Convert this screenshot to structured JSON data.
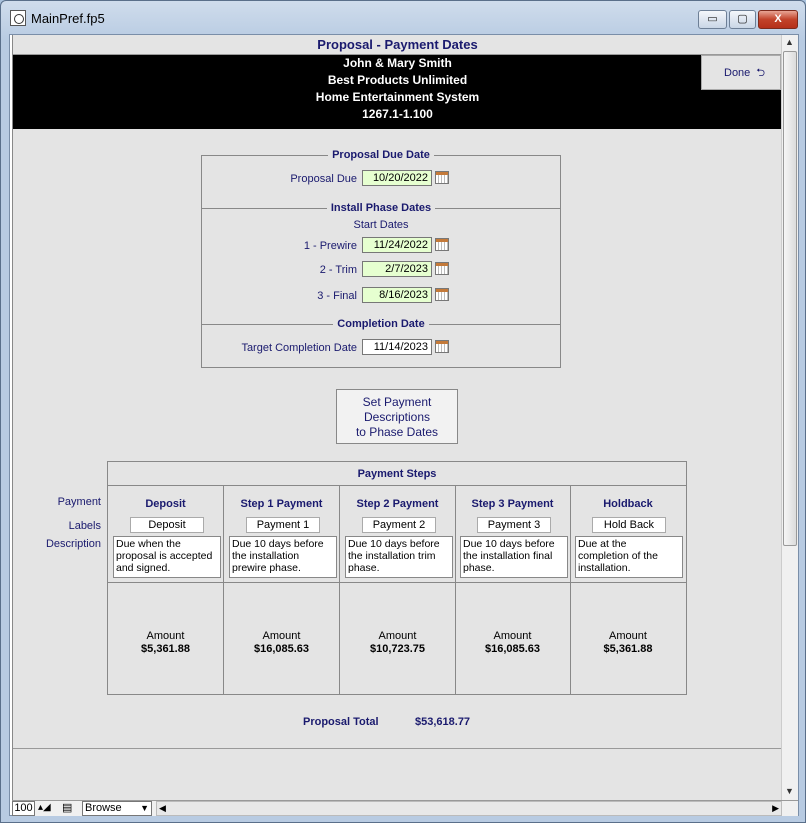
{
  "window": {
    "title": "MainPref.fp5",
    "min_label": "▭",
    "max_label": "▢",
    "close_label": "X"
  },
  "header": {
    "title": "Proposal - Payment Dates",
    "client_name": "John & Mary Smith",
    "company": "Best Products Unlimited",
    "project": "Home Entertainment System",
    "number": "1267.1-1.100",
    "done_label": "Done",
    "done_icon": "return-arrow-icon"
  },
  "proposal_due": {
    "section_title": "Proposal Due Date",
    "label": "Proposal Due",
    "value": "10/20/2022"
  },
  "install_phase": {
    "section_title": "Install Phase Dates",
    "subtitle": "Start Dates",
    "phases": [
      {
        "label": "1 - Prewire",
        "value": "11/24/2022"
      },
      {
        "label": "2 - Trim",
        "value": "2/7/2023"
      },
      {
        "label": "3 - Final",
        "value": "8/16/2023"
      }
    ]
  },
  "completion": {
    "section_title": "Completion Date",
    "label": "Target Completion Date",
    "value": "11/14/2023"
  },
  "set_button": {
    "line1": "Set Payment",
    "line2": "Descriptions",
    "line3": "to Phase Dates"
  },
  "payment_steps": {
    "title": "Payment Steps",
    "side_labels": {
      "payment": "Payment",
      "labels": "Labels",
      "description": "Description"
    },
    "amount_label": "Amount",
    "steps": [
      {
        "name": "Deposit",
        "label": "Deposit",
        "description": "Due when the proposal is accepted and signed.",
        "amount": "$5,361.88"
      },
      {
        "name": "Step 1 Payment",
        "label": "Payment 1",
        "description": "Due 10 days before the installation prewire phase.",
        "amount": "$16,085.63"
      },
      {
        "name": "Step 2 Payment",
        "label": "Payment 2",
        "description": "Due 10 days before the installation trim phase.",
        "amount": "$10,723.75"
      },
      {
        "name": "Step 3 Payment",
        "label": "Payment 3",
        "description": "Due 10 days before the installation final phase.",
        "amount": "$16,085.63"
      },
      {
        "name": "Holdback",
        "label": "Hold Back",
        "description": "Due at the completion of the installation.",
        "amount": "$5,361.88"
      }
    ]
  },
  "total": {
    "label": "Proposal Total",
    "value": "$53,618.77"
  },
  "statusbar": {
    "zoom": "100",
    "mode": "Browse"
  }
}
